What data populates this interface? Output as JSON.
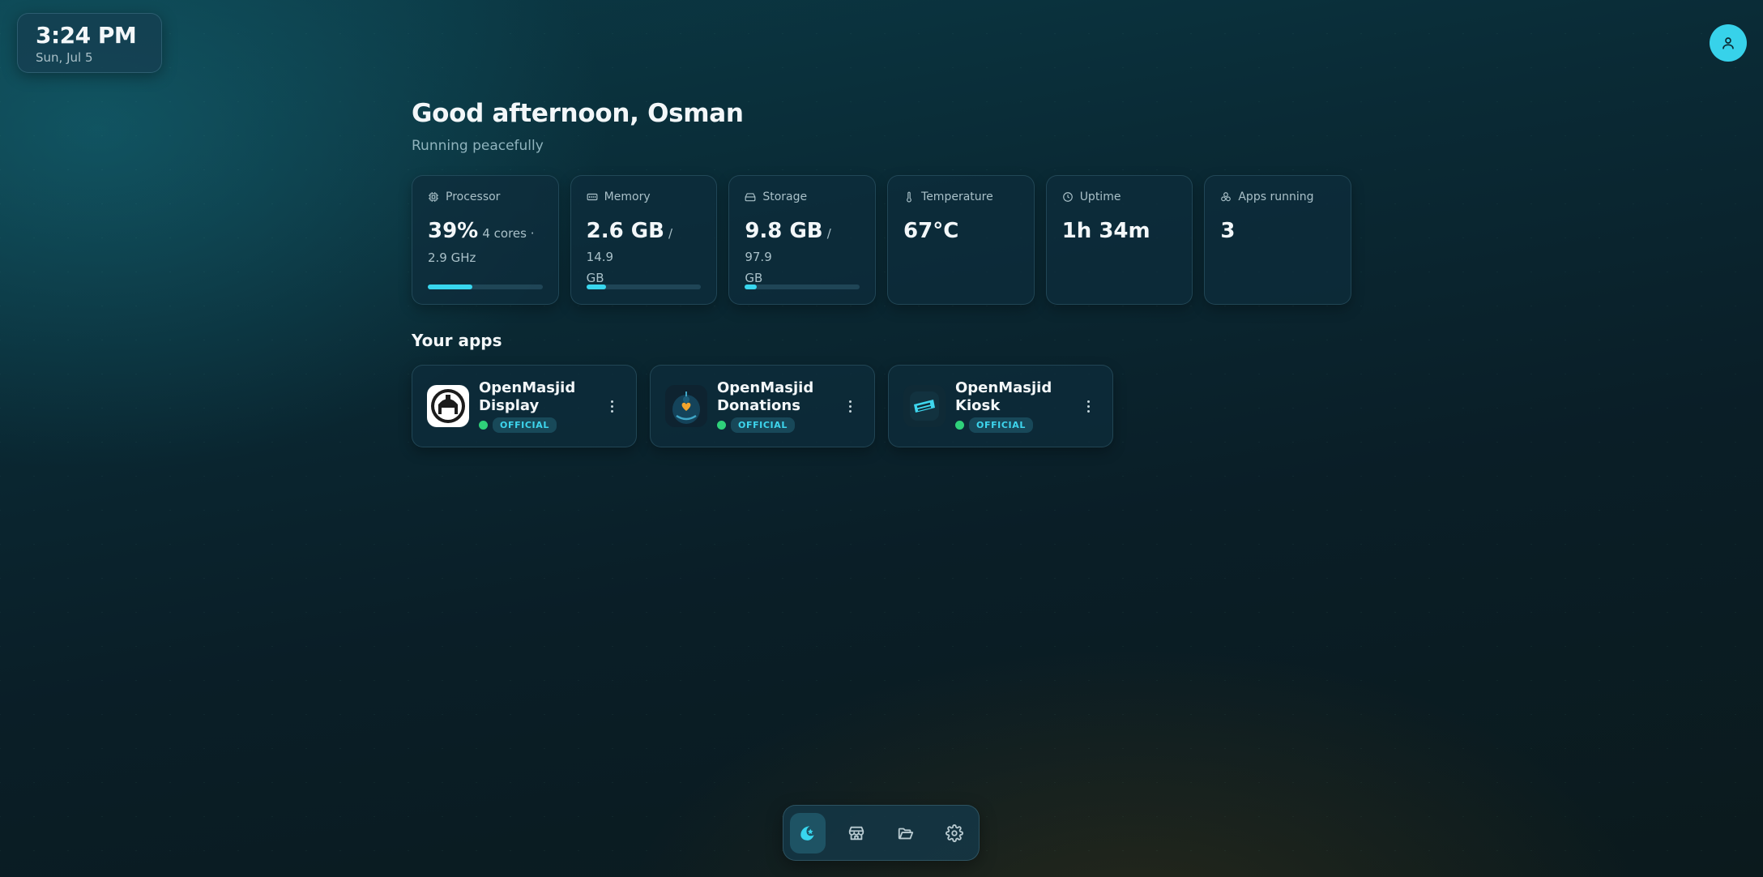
{
  "clock": {
    "time": "3:24 PM",
    "date": "Sun, Jul 5"
  },
  "header": {
    "greeting": "Good afternoon, Osman",
    "status": "Running peacefully"
  },
  "stats": [
    {
      "label": "Processor",
      "icon": "cpu-icon",
      "value": "39%",
      "detail": "4 cores ·",
      "detail2": "2.9 GHz",
      "progress": 0.39
    },
    {
      "label": "Memory",
      "icon": "memory-icon",
      "value": "2.6 GB",
      "detail": "/ 14.9",
      "detail2": "GB",
      "progress": 0.17
    },
    {
      "label": "Storage",
      "icon": "drive-icon",
      "value": "9.8 GB",
      "detail": "/ 97.9",
      "detail2": "GB",
      "progress": 0.1
    },
    {
      "label": "Temperature",
      "icon": "thermometer-icon",
      "value": "67°C"
    },
    {
      "label": "Uptime",
      "icon": "clock-icon",
      "value": "1h 34m"
    },
    {
      "label": "Apps running",
      "icon": "apps-icon",
      "value": "3"
    }
  ],
  "apps_section": {
    "title": "Your apps",
    "items": [
      {
        "name_line1": "OpenMasjid",
        "name_line2": "Display",
        "badge": "OFFICIAL",
        "icon": "display-app-icon"
      },
      {
        "name_line1": "OpenMasjid",
        "name_line2": "Donations",
        "badge": "OFFICIAL",
        "icon": "donations-app-icon"
      },
      {
        "name_line1": "OpenMasjid",
        "name_line2": "Kiosk",
        "badge": "OFFICIAL",
        "icon": "kiosk-app-icon"
      }
    ]
  },
  "dock": {
    "items": [
      {
        "icon": "home-logo-icon",
        "active": true
      },
      {
        "icon": "store-icon",
        "active": false
      },
      {
        "icon": "folder-icon",
        "active": false
      },
      {
        "icon": "settings-gear-icon",
        "active": false
      }
    ]
  },
  "colors": {
    "accent": "#38d6ee",
    "status_running": "#2fd17a",
    "avatar": "#37d2ea"
  }
}
